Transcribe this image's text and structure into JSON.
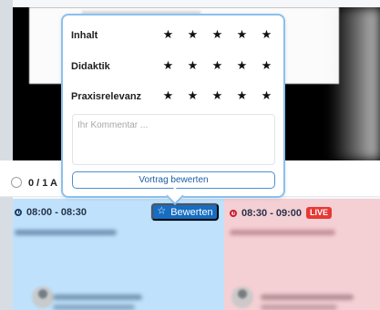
{
  "colors": {
    "accent_blue": "#176dc1",
    "popover_border": "#89c0ef",
    "slot_blue": "#bfe1fb",
    "slot_red": "#f4cfd4",
    "live_red": "#e53935"
  },
  "rating_popover": {
    "criteria": [
      {
        "label": "Inhalt",
        "stars": [
          "★",
          "★",
          "★",
          "★",
          "★"
        ]
      },
      {
        "label": "Didaktik",
        "stars": [
          "★",
          "★",
          "★",
          "★",
          "★"
        ]
      },
      {
        "label": "Praxisrelevanz",
        "stars": [
          "★",
          "★",
          "★",
          "★",
          "★"
        ]
      }
    ],
    "comment_placeholder": "Ihr Kommentar ...",
    "submit_label": "Vortrag bewerten"
  },
  "controls": {
    "visible_count": "0 / 1 A"
  },
  "schedule": {
    "left_slot": {
      "time": "08:00 - 08:30",
      "rate_button": "Bewerten",
      "rate_icon": "star-outline-icon"
    },
    "right_slot": {
      "time": "08:30 - 09:00",
      "status": "LIVE"
    }
  }
}
